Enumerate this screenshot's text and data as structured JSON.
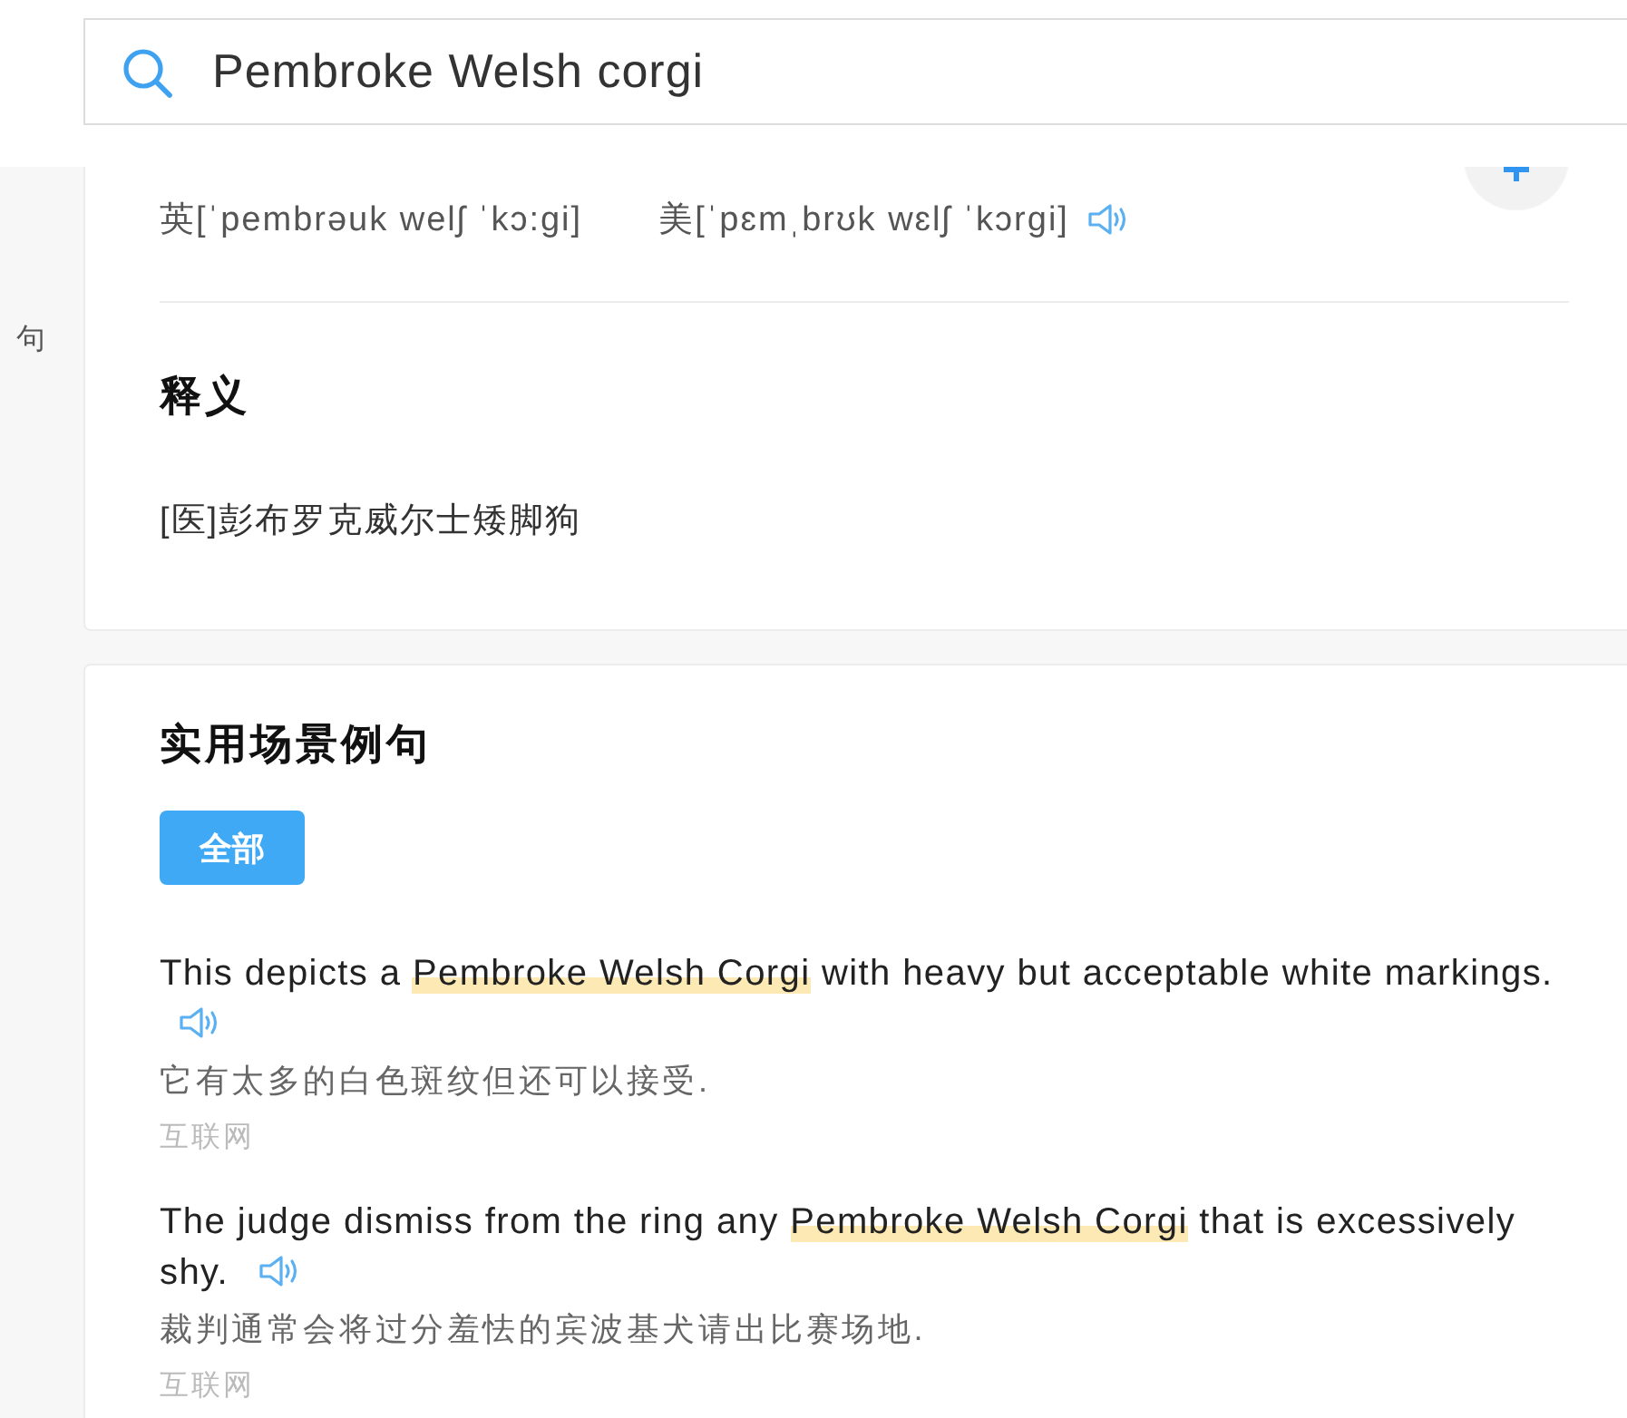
{
  "search": {
    "value": "Pembroke Welsh corgi"
  },
  "sidebar": {
    "items": [
      {
        "label": "句"
      }
    ]
  },
  "pronunciation": {
    "items": [
      {
        "label": "英[ˈpembrəuk welʃ ˈkɔ:gi]",
        "audio": false
      },
      {
        "label": "美[ˈpɛmˌbrʊk wɛlʃ ˈkɔrgi]",
        "audio": true
      }
    ]
  },
  "definition": {
    "title": "释义",
    "items": [
      "[医]彭布罗克威尔士矮脚狗"
    ]
  },
  "examples": {
    "title": "实用场景例句",
    "filters": [
      {
        "label": "全部",
        "selected": true
      }
    ],
    "sentences": [
      {
        "parts": [
          {
            "text": "This depicts a ",
            "highlight": false
          },
          {
            "text": "Pembroke Welsh Corgi",
            "highlight": true
          },
          {
            "text": " with heavy but acceptable white markings.",
            "highlight": false
          }
        ],
        "audio": true,
        "translation": "它有太多的白色斑纹但还可以接受.",
        "source": "互联网"
      },
      {
        "parts": [
          {
            "text": "The judge dismiss from the ring any ",
            "highlight": false
          },
          {
            "text": "Pembroke Welsh Corgi",
            "highlight": true
          },
          {
            "text": " that is excessively shy.",
            "highlight": false
          }
        ],
        "audio": true,
        "translation": "裁判通常会将过分羞怯的宾波基犬请出比赛场地.",
        "source": "互联网"
      }
    ]
  }
}
